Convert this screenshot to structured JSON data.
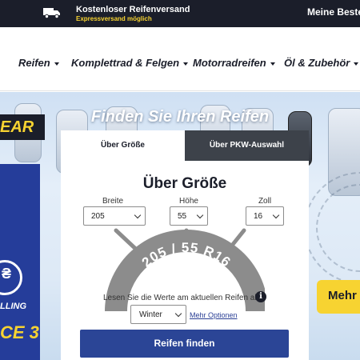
{
  "topbar": {
    "shipping_title": "Kostenloser Reifenversand",
    "shipping_sub": "Expressversand möglich",
    "orders_label": "Meine Bestel",
    "truck_icon": "truck-icon"
  },
  "nav": {
    "items": [
      {
        "label": "Reifen"
      },
      {
        "label": "Komplettrad & Felgen"
      },
      {
        "label": "Motorradreifen"
      },
      {
        "label": "Öl & Zubehör"
      }
    ]
  },
  "hero": {
    "title": "Finden Sie Ihren Reifen",
    "brand_fragment": "EAR",
    "ad_text_1": "LLING",
    "ad_text_2": "CE 3",
    "more_button": "Mehr"
  },
  "search": {
    "tabs": [
      {
        "label": "Über Größe",
        "active": true
      },
      {
        "label": "Über PKW-Auswahl",
        "active": false
      }
    ],
    "title": "Über Größe",
    "width_label": "Breite",
    "width_value": "205",
    "height_label": "Höhe",
    "height_value": "55",
    "rim_label": "Zoll",
    "rim_value": "16",
    "tire_text": "205 / 55 R16",
    "hint": "Lesen Sie die Werte am aktuellen Reifen ab",
    "season_value": "Winter",
    "more_options": "Mehr Optionen",
    "submit": "Reifen finden"
  },
  "colors": {
    "brand_dark": "#1b1e2a",
    "accent_yellow": "#f7d331",
    "button_blue": "#2b4596"
  }
}
